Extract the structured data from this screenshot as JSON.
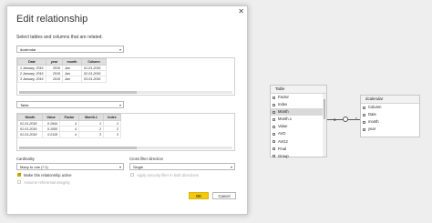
{
  "dialog": {
    "title": "Edit relationship",
    "subtitle": "Select tables and columns that are related.",
    "table1": {
      "selected": "dcalendar",
      "columns": [
        "Date",
        "year",
        "month",
        "Column"
      ],
      "rows": [
        [
          "1 January, 2016",
          "2016",
          "Jan",
          "01-01-2016"
        ],
        [
          "2 January, 2016",
          "2016",
          "Jan",
          "02-01-2016"
        ],
        [
          "3 January, 2016",
          "2016",
          "Jan",
          "03-01-2016"
        ]
      ]
    },
    "table2": {
      "selected": "Table",
      "columns": [
        "Month",
        "Value",
        "Factor",
        "Month.1",
        "Index"
      ],
      "rows": [
        [
          "01-01-2018",
          "0.1944",
          "4",
          "1",
          "1"
        ],
        [
          "01-01-2018",
          "0.1050",
          "4",
          "2",
          "2"
        ],
        [
          "01-01-2018",
          "0.2118",
          "4",
          "3",
          "3"
        ]
      ]
    },
    "cardinality": {
      "label": "Cardinality",
      "value": "Many to one (*:1)"
    },
    "crossfilter": {
      "label": "Cross filter direction",
      "value": "Single"
    },
    "options": {
      "make_active": "Make this relationship active",
      "security_filter": "Apply security filter in both directions",
      "referential": "Assume referential integrity"
    },
    "ok_label": "OK",
    "cancel_label": "Cancel",
    "close_glyph": "✕"
  },
  "model": {
    "left_table": {
      "title": "Table",
      "fields": [
        "Factor",
        "Index",
        "Month",
        "Month.1",
        "Value",
        "AVG",
        "AVG2",
        "Final",
        "Group"
      ]
    },
    "right_table": {
      "title": "dcalendar",
      "fields": [
        "Column",
        "Date",
        "month",
        "year"
      ]
    },
    "relationship": {
      "many": "*",
      "one": "1"
    }
  },
  "colors": {
    "accent": "#f2c811"
  }
}
